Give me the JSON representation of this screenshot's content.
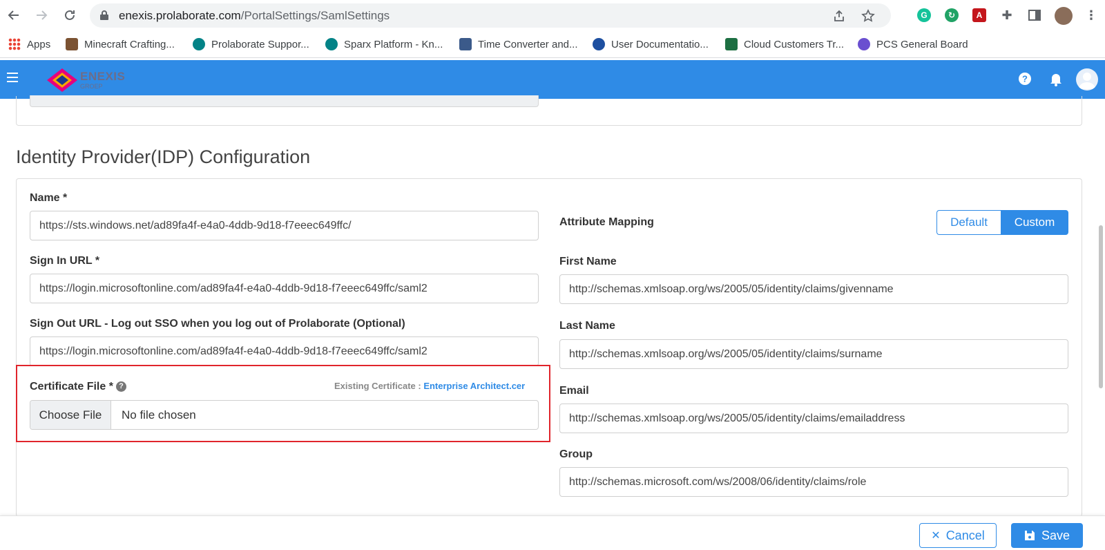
{
  "browser": {
    "url_host": "enexis.prolaborate.com",
    "url_path": "/PortalSettings/SamlSettings"
  },
  "bookmarks": [
    {
      "label": "Apps",
      "icon": "apps-grid-icon"
    },
    {
      "label": "Minecraft Crafting...",
      "icon": "minecraft-icon"
    },
    {
      "label": "Prolaborate Suppor...",
      "icon": "sharepoint-icon"
    },
    {
      "label": "Sparx Platform - Kn...",
      "icon": "sharepoint-icon"
    },
    {
      "label": "Time Converter and...",
      "icon": "time-converter-icon"
    },
    {
      "label": "User Documentatio...",
      "icon": "prolaborate-icon"
    },
    {
      "label": "Cloud Customers Tr...",
      "icon": "excel-icon"
    },
    {
      "label": "PCS General Board",
      "icon": "pcs-board-icon"
    }
  ],
  "app": {
    "logo_text": "ENEXIS",
    "logo_sub": "GROEP",
    "colors": {
      "primary": "#2f8be6",
      "danger": "#e0242b"
    }
  },
  "idp": {
    "section_title": "Identity Provider(IDP) Configuration",
    "name_label": "Name *",
    "name_value": "https://sts.windows.net/ad89fa4f-e4a0-4ddb-9d18-f7eeec649ffc/",
    "signin_label": "Sign In URL *",
    "signin_value": "https://login.microsoftonline.com/ad89fa4f-e4a0-4ddb-9d18-f7eeec649ffc/saml2",
    "signout_label": "Sign Out URL - Log out SSO when you log out of Prolaborate (Optional)",
    "signout_value": "https://login.microsoftonline.com/ad89fa4f-e4a0-4ddb-9d18-f7eeec649ffc/saml2",
    "cert_label": "Certificate File *",
    "cert_help": "?",
    "existing_label": "Existing Certificate : ",
    "existing_file": "Enterprise Architect.cer",
    "choose_file": "Choose File",
    "no_file": "No file chosen"
  },
  "mapping": {
    "title": "Attribute Mapping",
    "default_label": "Default",
    "custom_label": "Custom",
    "first_name_label": "First Name",
    "first_name_value": "http://schemas.xmlsoap.org/ws/2005/05/identity/claims/givenname",
    "last_name_label": "Last Name",
    "last_name_value": "http://schemas.xmlsoap.org/ws/2005/05/identity/claims/surname",
    "email_label": "Email",
    "email_value": "http://schemas.xmlsoap.org/ws/2005/05/identity/claims/emailaddress",
    "group_label": "Group",
    "group_value": "http://schemas.microsoft.com/ws/2008/06/identity/claims/role"
  },
  "footer": {
    "cancel_label": "Cancel",
    "save_label": "Save"
  }
}
